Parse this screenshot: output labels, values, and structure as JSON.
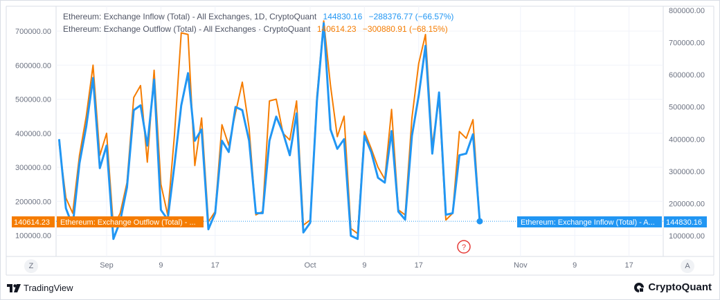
{
  "legend": {
    "inflow_text": "Ethereum: Exchange Inflow (Total) - All Exchanges, 1D, CryptoQuant",
    "inflow_value": "144830.16",
    "inflow_change": "−288376.77 (−66.57%)",
    "outflow_text": "Ethereum: Exchange Outflow (Total) - All Exchanges · CryptoQuant",
    "outflow_value": "140614.23",
    "outflow_change": "−300880.91 (−68.15%)"
  },
  "tags": {
    "outflow_price": "140614.23",
    "outflow_name": "Ethereum: Exchange Outflow (Total) - ...",
    "inflow_name": "Ethereum: Exchange Inflow (Total) - A...",
    "inflow_price": "144830.16"
  },
  "buttons": {
    "left_axis": "Z",
    "right_axis": "A",
    "help": "?"
  },
  "footer": {
    "tradingview": "TradingView",
    "cryptoquant": "CryptoQuant"
  },
  "colors": {
    "inflow": "#2196f3",
    "outflow": "#f57c00",
    "help": "#e53935"
  },
  "chart_data": {
    "type": "line",
    "left_axis": {
      "ticks": [
        "700000.00",
        "600000.00",
        "500000.00",
        "400000.00",
        "300000.00",
        "200000.00",
        "100000.00"
      ],
      "tick_values": [
        700000,
        600000,
        500000,
        400000,
        300000,
        200000,
        100000
      ]
    },
    "right_axis": {
      "ticks": [
        "800000.00",
        "700000.00",
        "600000.00",
        "500000.00",
        "400000.00",
        "300000.00",
        "200000.00",
        "100000.00"
      ],
      "tick_values": [
        800000,
        700000,
        600000,
        500000,
        400000,
        300000,
        200000,
        100000
      ]
    },
    "x_ticks": [
      "Sep",
      "9",
      "17",
      "Oct",
      "9",
      "17",
      "Nov",
      "9",
      "17"
    ],
    "x_tick_days": [
      0,
      8,
      16,
      30,
      38,
      46,
      61,
      69,
      77
    ],
    "last_value_day": 53,
    "series": [
      {
        "name": "Ethereum: Exchange Inflow (Total) - All Exchanges, 1D, CryptoQuant",
        "color": "#2196f3",
        "axis": "right",
        "points": [
          [
            -7,
            400000
          ],
          [
            -6,
            185000
          ],
          [
            -5,
            130000
          ],
          [
            -4,
            325000
          ],
          [
            -3,
            440000
          ],
          [
            -2,
            590000
          ],
          [
            -1,
            310000
          ],
          [
            0,
            380000
          ],
          [
            1,
            90000
          ],
          [
            2,
            145000
          ],
          [
            3,
            250000
          ],
          [
            4,
            490000
          ],
          [
            5,
            505000
          ],
          [
            6,
            380000
          ],
          [
            7,
            585000
          ],
          [
            8,
            180000
          ],
          [
            9,
            150000
          ],
          [
            10,
            320000
          ],
          [
            11,
            505000
          ],
          [
            12,
            605000
          ],
          [
            13,
            395000
          ],
          [
            14,
            430000
          ],
          [
            15,
            120000
          ],
          [
            16,
            170000
          ],
          [
            17,
            395000
          ],
          [
            18,
            360000
          ],
          [
            19,
            500000
          ],
          [
            20,
            490000
          ],
          [
            21,
            395000
          ],
          [
            22,
            170000
          ],
          [
            23,
            170000
          ],
          [
            24,
            395000
          ],
          [
            25,
            470000
          ],
          [
            26,
            420000
          ],
          [
            27,
            350000
          ],
          [
            28,
            480000
          ],
          [
            29,
            110000
          ],
          [
            30,
            140000
          ],
          [
            31,
            520000
          ],
          [
            32,
            760000
          ],
          [
            33,
            430000
          ],
          [
            34,
            370000
          ],
          [
            35,
            400000
          ],
          [
            36,
            100000
          ],
          [
            37,
            90000
          ],
          [
            38,
            410000
          ],
          [
            39,
            360000
          ],
          [
            40,
            280000
          ],
          [
            41,
            265000
          ],
          [
            42,
            425000
          ],
          [
            43,
            175000
          ],
          [
            44,
            150000
          ],
          [
            45,
            410000
          ],
          [
            46,
            535000
          ],
          [
            47,
            690000
          ],
          [
            48,
            355000
          ],
          [
            49,
            545000
          ],
          [
            50,
            165000
          ],
          [
            51,
            170000
          ],
          [
            52,
            350000
          ],
          [
            53,
            355000
          ],
          [
            54,
            415000
          ],
          [
            55,
            144830
          ]
        ]
      },
      {
        "name": "Ethereum: Exchange Outflow (Total) - All Exchanges · CryptoQuant",
        "color": "#f57c00",
        "axis": "left",
        "points": [
          [
            -7,
            370000
          ],
          [
            -6,
            210000
          ],
          [
            -5,
            165000
          ],
          [
            -4,
            335000
          ],
          [
            -3,
            450000
          ],
          [
            -2,
            600000
          ],
          [
            -1,
            335000
          ],
          [
            0,
            400000
          ],
          [
            1,
            125000
          ],
          [
            2,
            165000
          ],
          [
            3,
            255000
          ],
          [
            4,
            505000
          ],
          [
            5,
            540000
          ],
          [
            6,
            315000
          ],
          [
            7,
            585000
          ],
          [
            8,
            250000
          ],
          [
            9,
            160000
          ],
          [
            10,
            395000
          ],
          [
            11,
            695000
          ],
          [
            12,
            690000
          ],
          [
            13,
            305000
          ],
          [
            14,
            445000
          ],
          [
            15,
            140000
          ],
          [
            16,
            170000
          ],
          [
            17,
            425000
          ],
          [
            18,
            365000
          ],
          [
            19,
            460000
          ],
          [
            20,
            550000
          ],
          [
            21,
            415000
          ],
          [
            22,
            160000
          ],
          [
            23,
            170000
          ],
          [
            24,
            495000
          ],
          [
            25,
            500000
          ],
          [
            26,
            400000
          ],
          [
            27,
            380000
          ],
          [
            28,
            495000
          ],
          [
            29,
            130000
          ],
          [
            30,
            145000
          ],
          [
            31,
            510000
          ],
          [
            32,
            730000
          ],
          [
            33,
            540000
          ],
          [
            34,
            390000
          ],
          [
            35,
            450000
          ],
          [
            36,
            120000
          ],
          [
            37,
            105000
          ],
          [
            38,
            405000
          ],
          [
            39,
            355000
          ],
          [
            40,
            300000
          ],
          [
            41,
            265000
          ],
          [
            42,
            470000
          ],
          [
            43,
            175000
          ],
          [
            44,
            160000
          ],
          [
            45,
            445000
          ],
          [
            46,
            605000
          ],
          [
            47,
            690000
          ],
          [
            48,
            365000
          ],
          [
            49,
            500000
          ],
          [
            50,
            145000
          ],
          [
            51,
            165000
          ],
          [
            52,
            405000
          ],
          [
            53,
            385000
          ],
          [
            54,
            440000
          ],
          [
            55,
            140614
          ]
        ]
      }
    ]
  }
}
